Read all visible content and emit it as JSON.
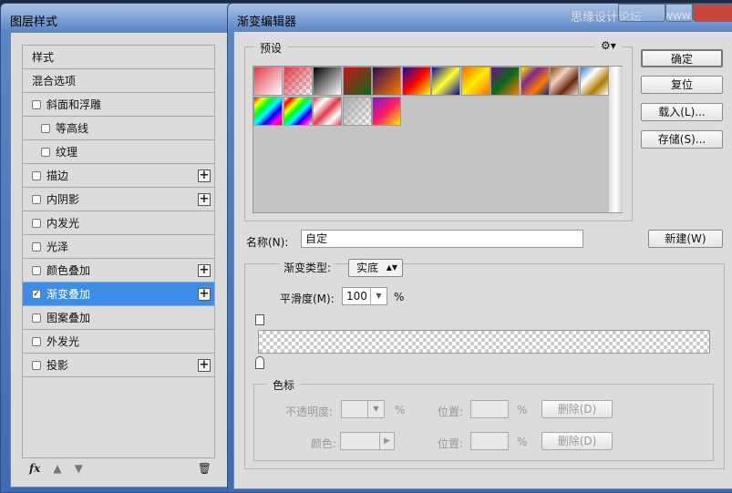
{
  "left_window": {
    "title": "图层样式",
    "items": [
      {
        "label": "样式",
        "checkbox": false,
        "plus": false,
        "indent": false
      },
      {
        "label": "混合选项",
        "checkbox": false,
        "plus": false,
        "indent": false
      },
      {
        "label": "斜面和浮雕",
        "checkbox": true,
        "checked": false,
        "plus": false,
        "indent": false
      },
      {
        "label": "等高线",
        "checkbox": true,
        "checked": false,
        "plus": false,
        "indent": true
      },
      {
        "label": "纹理",
        "checkbox": true,
        "checked": false,
        "plus": false,
        "indent": true
      },
      {
        "label": "描边",
        "checkbox": true,
        "checked": false,
        "plus": true,
        "indent": false
      },
      {
        "label": "内阴影",
        "checkbox": true,
        "checked": false,
        "plus": true,
        "indent": false
      },
      {
        "label": "内发光",
        "checkbox": true,
        "checked": false,
        "plus": false,
        "indent": false
      },
      {
        "label": "光泽",
        "checkbox": true,
        "checked": false,
        "plus": false,
        "indent": false
      },
      {
        "label": "颜色叠加",
        "checkbox": true,
        "checked": false,
        "plus": true,
        "indent": false
      },
      {
        "label": "渐变叠加",
        "checkbox": true,
        "checked": true,
        "plus": true,
        "indent": false,
        "selected": true
      },
      {
        "label": "图案叠加",
        "checkbox": true,
        "checked": false,
        "plus": false,
        "indent": false
      },
      {
        "label": "外发光",
        "checkbox": true,
        "checked": false,
        "plus": false,
        "indent": false
      },
      {
        "label": "投影",
        "checkbox": true,
        "checked": false,
        "plus": true,
        "indent": false
      }
    ],
    "toolbar": {
      "fx": "fx",
      "up_icon": "arrow-up-icon",
      "down_icon": "arrow-down-icon",
      "trash_icon": "trash-icon"
    }
  },
  "right_window": {
    "title": "渐变编辑器",
    "watermark": "思缘设计论坛",
    "watermark_url": "WWW.MISSYUAN.COM",
    "presets_label": "预设",
    "presets": [
      [
        "#e23a4a",
        "#fff"
      ],
      [
        "#e23a4a",
        "transparent"
      ],
      [
        "#000",
        "#fff"
      ],
      [
        "#d0101a",
        "#0a6a1a"
      ],
      [
        "#2a0a5a",
        "#ff7a00"
      ],
      [
        "#1010a0",
        "#ff0000",
        "#ffff00"
      ],
      [
        "#0a0aa0",
        "#ffff30",
        "#0a0aa0"
      ],
      [
        "#ff6a00",
        "#ffee00",
        "#ff6a00"
      ],
      [
        "#7a0a8a",
        "#0a6a1a",
        "#ff7a00"
      ],
      [
        "#ffee00",
        "#7a2a8a",
        "#ff7a00",
        "#0a2a8a"
      ],
      [
        "#8a4a10",
        "#f0d0c0",
        "#6a2a0a",
        "#f0d8c8"
      ],
      [
        "#2a80d0",
        "#fff",
        "#b07a00",
        "#fff"
      ],
      [
        "#ff0000",
        "#ffff00",
        "#00ff00",
        "#00ffff",
        "#0000ff",
        "#ff00ff",
        "#ff0000"
      ],
      [
        "transparent",
        "#ff0000",
        "#ffff00",
        "#00ff00",
        "#00ffff",
        "#0000ff",
        "#ff00ff",
        "transparent"
      ],
      [
        "#e23a4a",
        "#fff",
        "#e23a4a",
        "#fff",
        "#e23a4a"
      ],
      [
        "#aaa",
        "transparent"
      ],
      [
        "#7a1ad0",
        "#ff1a6a",
        "#ffee00"
      ]
    ],
    "buttons": {
      "ok": "确定",
      "reset": "复位",
      "load": "载入(L)...",
      "save": "存储(S)...",
      "new": "新建(W)"
    },
    "name_label": "名称(N):",
    "name_value": "自定",
    "type_label": "渐变类型:",
    "type_value": "实底",
    "smooth_label": "平滑度(M):",
    "smooth_value": "100",
    "percent": "%",
    "stops": {
      "legend": "色标",
      "opacity_label": "不透明度:",
      "color_label": "颜色:",
      "location_label": "位置:",
      "delete": "删除(D)"
    }
  }
}
